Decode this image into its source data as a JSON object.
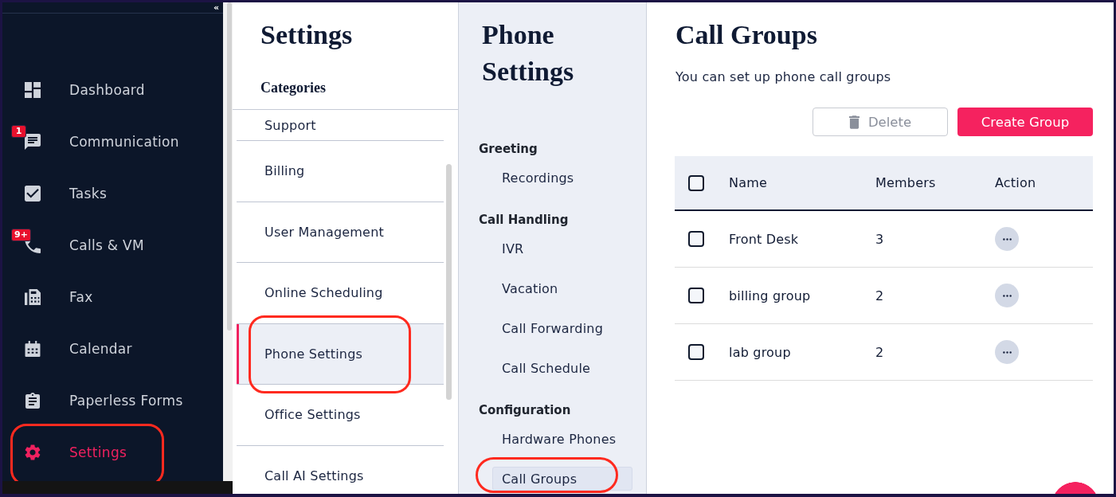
{
  "sidebar": {
    "collapse_label": "«",
    "items": [
      {
        "label": "Dashboard",
        "selected": false,
        "circled": false
      },
      {
        "label": "Communication",
        "badge": "1",
        "selected": false,
        "circled": false
      },
      {
        "label": "Tasks",
        "selected": false,
        "circled": false
      },
      {
        "label": "Calls & VM",
        "badge": "9+",
        "selected": false,
        "circled": false
      },
      {
        "label": "Fax",
        "selected": false,
        "circled": false
      },
      {
        "label": "Calendar",
        "selected": false,
        "circled": false
      },
      {
        "label": "Paperless Forms",
        "selected": false,
        "circled": false
      },
      {
        "label": "Settings",
        "selected": true,
        "circled": true
      }
    ]
  },
  "settings_panel": {
    "title": "Settings",
    "subtitle": "Categories",
    "categories": [
      {
        "label": "Support",
        "selected": false,
        "circled": false
      },
      {
        "label": "Billing",
        "selected": false,
        "circled": false
      },
      {
        "label": "User Management",
        "selected": false,
        "circled": false
      },
      {
        "label": "Online Scheduling",
        "selected": false,
        "circled": false
      },
      {
        "label": "Phone Settings",
        "selected": true,
        "circled": true
      },
      {
        "label": "Office Settings",
        "selected": false,
        "circled": false
      },
      {
        "label": "Call AI Settings",
        "selected": false,
        "circled": false
      }
    ]
  },
  "phone_settings": {
    "title": "Phone Settings",
    "groups": [
      {
        "heading": "Greeting",
        "items": [
          {
            "label": "Recordings",
            "selected": false,
            "circled": false
          }
        ]
      },
      {
        "heading": "Call Handling",
        "items": [
          {
            "label": "IVR",
            "selected": false,
            "circled": false
          },
          {
            "label": "Vacation",
            "selected": false,
            "circled": false
          },
          {
            "label": "Call Forwarding",
            "selected": false,
            "circled": false
          },
          {
            "label": "Call Schedule",
            "selected": false,
            "circled": false
          }
        ]
      },
      {
        "heading": "Configuration",
        "items": [
          {
            "label": "Hardware Phones",
            "selected": false,
            "circled": false
          },
          {
            "label": "Call Groups",
            "selected": true,
            "circled": true
          }
        ]
      }
    ]
  },
  "call_groups": {
    "title": "Call Groups",
    "description": "You can set up phone call groups",
    "buttons": [
      {
        "kind": "delete",
        "label": "Delete",
        "disabled": true
      },
      {
        "kind": "create",
        "label": "Create Group",
        "disabled": false
      }
    ],
    "table": {
      "columns": [
        "Name",
        "Members",
        "Action"
      ],
      "header_checked": false,
      "rows": [
        {
          "name": "Front Desk",
          "members": "3",
          "checked": false
        },
        {
          "name": "billing group",
          "members": "2",
          "checked": false
        },
        {
          "name": "lab group",
          "members": "2",
          "checked": false
        }
      ]
    }
  }
}
